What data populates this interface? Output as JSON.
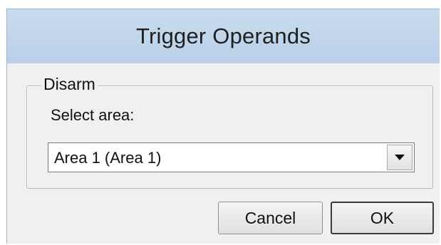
{
  "dialog": {
    "title": "Trigger Operands"
  },
  "group": {
    "legend": "Disarm",
    "field_label": "Select area:",
    "select": {
      "value": "Area 1 (Area 1)",
      "dropdown_icon": "chevron-down-icon"
    }
  },
  "buttons": {
    "cancel_label": "Cancel",
    "ok_label": "OK"
  },
  "colors": {
    "titlebar": "#c2d7ec",
    "dialog_bg": "#f0f0f0",
    "field_bg": "#ffffff"
  }
}
